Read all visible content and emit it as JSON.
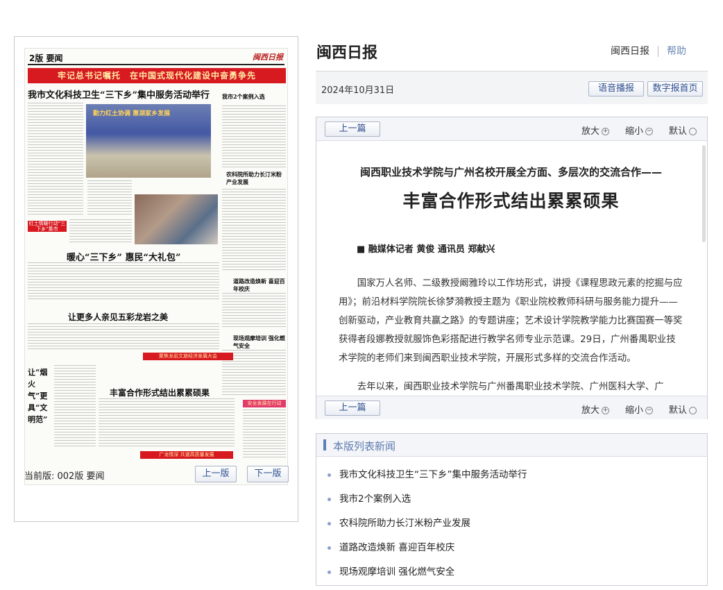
{
  "site": {
    "title": "闽西日报",
    "nav": [
      "闽西日报",
      "帮助"
    ]
  },
  "date_bar": {
    "date": "2024年10月31日",
    "voice_button": "语音播报",
    "home_button": "数字报首页"
  },
  "page_preview": {
    "page_no": "2版",
    "section": "要闻",
    "masthead": "闽西日报",
    "banner": "牢记总书记嘱托　在中国式现代化建设中奋勇争先",
    "headlines": [
      "我市文化科技卫生“三下乡”集中服务活动举行",
      "暖心“三下乡” 惠民“大礼包”",
      "让更多人亲见五彩龙岩之美",
      "丰富合作形式结出累累硕果"
    ],
    "side_headlines": [
      "我市2个案例入选",
      "农科院所助力长汀米粉产业发展",
      "道路改造焕新 喜迎百年校庆",
      "现场观摩培训 强化燃气安全"
    ],
    "photo_caption": "勤力红土协调 惠湖家乡发展",
    "red_tag": "红土情暖行动“三下乡”集市",
    "red_bars": [
      "聚焦龙岩文旅经济发展大会",
      "广龙情深 共谱高质量发展",
      "安全发展在行动"
    ],
    "pillar_text": "让“烟火气”更具“文明范”"
  },
  "page_nav": {
    "current_label": "当前版: 002版 要闻",
    "prev_button": "上一版",
    "next_button": "下一版"
  },
  "article_tools": {
    "prev_article": "上一篇",
    "zoom_in": "放大",
    "zoom_out": "缩小",
    "default": "默认",
    "zoom_in_symbol": "+",
    "zoom_out_symbol": "−",
    "default_symbol": "○"
  },
  "article": {
    "subtitle": "闽西职业技术学院与广州名校开展全方面、多层次的交流合作——",
    "title": "丰富合作形式结出累累硕果",
    "byline": "■ 融媒体记者 黄俊 通讯员 郑献兴",
    "paragraphs": [
      "国家万人名师、二级教授阚雅玲以工作坊形式，讲授《课程思政元素的挖掘与应用》；前沿材料学院院长徐梦漪教授주题为《职业院校教师科研与服务能力提升——创新驱动，产业教育共赢之路》的专题讲座；艺术设计学院教学能力比赛国赛一等奖获得者段娜教授就服饰色彩搭配进行教学名师专业示范课。29日，广州番禺职业技术学院的老师们来到闽西职业技术学院，开展形式多样的交流合作活动。",
      "去年以来，闽西职业技术学院与广州番禺职业技术学院、广州医科大学、广"
    ]
  },
  "news_list": {
    "heading": "本版列表新闻",
    "items": [
      "我市文化科技卫生“三下乡”集中服务活动举行",
      "我市2个案例入选",
      "农科院所助力长汀米粉产业发展",
      "道路改造焕新 喜迎百年校庆",
      "现场观摩培训 强化燃气安全"
    ]
  }
}
